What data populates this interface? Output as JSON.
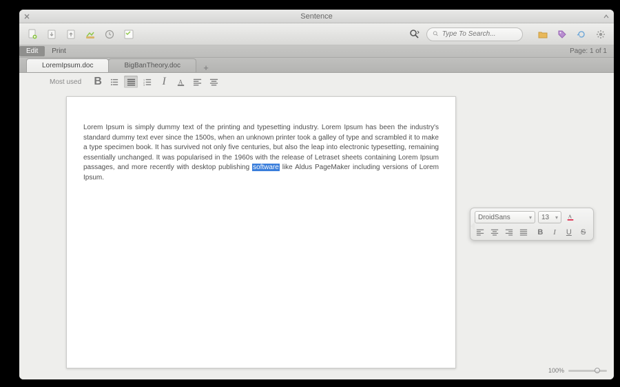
{
  "window": {
    "title": "Sentence"
  },
  "menu": {
    "edit": "Edit",
    "print": "Print",
    "page_indicator": "Page: 1 of 1"
  },
  "search": {
    "placeholder": "Type To Search..."
  },
  "tabs": [
    {
      "label": "LoremIpsum.doc",
      "active": true
    },
    {
      "label": "BigBanTheory.doc",
      "active": false
    }
  ],
  "ribbon": {
    "label": "Most used"
  },
  "document": {
    "pre": "Lorem Ipsum is simply dummy text of the printing and typesetting industry. Lorem Ipsum has been the industry's standard dummy text ever since the 1500s, when an unknown printer took a galley of type and scrambled it to make a type specimen book. It has survived not only five centuries, but also the leap into electronic typesetting, remaining essentially unchanged. It was popularised in the 1960s with the release of Letraset sheets containing Lorem Ipsum passages, and more recently with desktop publishing ",
    "selected": "software",
    "post": " like Aldus PageMaker including versions of Lorem Ipsum."
  },
  "float": {
    "font": "DroidSans",
    "size": "13"
  },
  "zoom": {
    "label": "100%"
  }
}
